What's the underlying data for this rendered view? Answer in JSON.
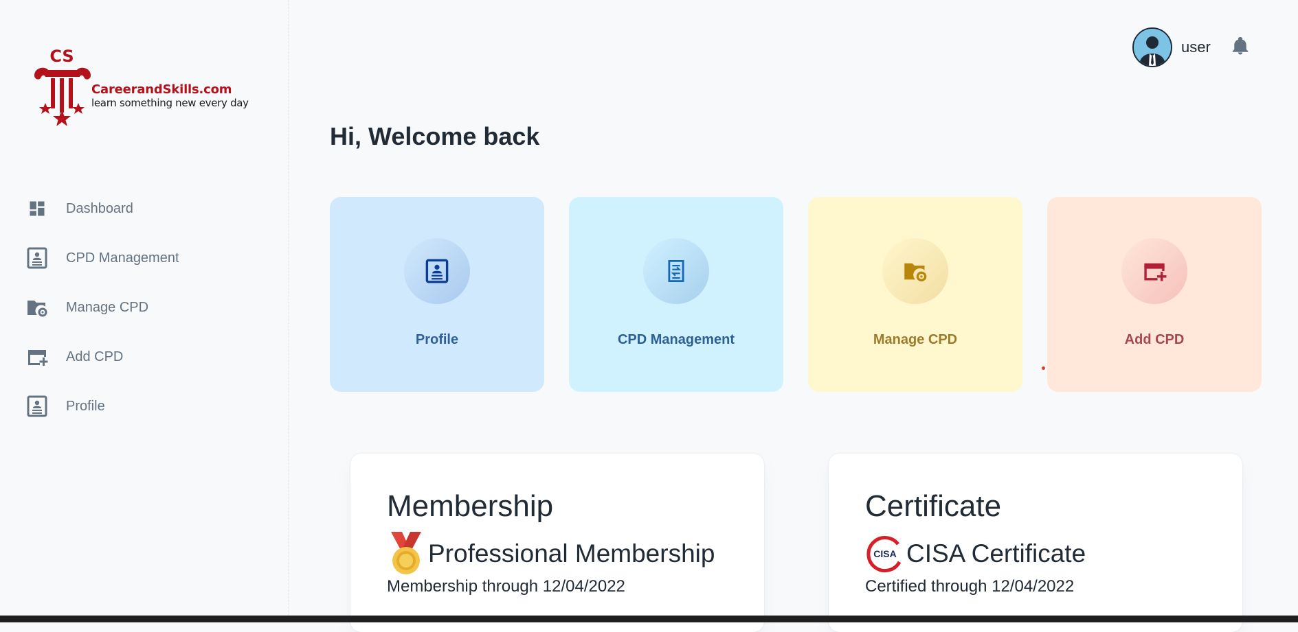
{
  "logo": {
    "monogram": "CS",
    "brand": "CareerandSkills.com",
    "tagline": "learn something new every day"
  },
  "sidebar": {
    "items": [
      {
        "label": "Dashboard",
        "icon": "dashboard-icon"
      },
      {
        "label": "CPD Management",
        "icon": "profile-card-icon"
      },
      {
        "label": "Manage CPD",
        "icon": "folder-gear-icon"
      },
      {
        "label": "Add CPD",
        "icon": "card-plus-icon"
      },
      {
        "label": "Profile",
        "icon": "profile-card-icon"
      }
    ]
  },
  "topbar": {
    "username": "user",
    "avatar_icon": "user-avatar",
    "bell_icon": "bell-icon"
  },
  "main": {
    "welcome": "Hi, Welcome back",
    "tiles": [
      {
        "label": "Profile",
        "icon": "profile-card-icon",
        "bg": "#d1e9fc",
        "circle": "#b6d3f1",
        "color": "#0c3c9a",
        "text": "#2f5e9b"
      },
      {
        "label": "CPD Management",
        "icon": "transfer-list-icon",
        "bg": "#d0f2ff",
        "circle": "#b5dbf2",
        "color": "#1468b8",
        "text": "#2c5f96"
      },
      {
        "label": "Manage CPD",
        "icon": "folder-gear-icon",
        "bg": "#fff7cd",
        "circle": "#f7e6b1",
        "color": "#b7860b",
        "text": "#9c7c2c"
      },
      {
        "label": "Add CPD",
        "icon": "card-plus-icon",
        "bg": "#ffe7d9",
        "circle": "#f7cbc3",
        "color": "#b21f37",
        "text": "#a6474f"
      }
    ],
    "cards": [
      {
        "title": "Membership",
        "name": "Professional Membership",
        "through": "Membership through 12/04/2022",
        "icon": "medal-icon"
      },
      {
        "title": "Certificate",
        "name": "CISA Certificate",
        "through": "Certified through 12/04/2022",
        "icon": "cisa-logo-icon",
        "badge_text": "CISA"
      }
    ]
  }
}
